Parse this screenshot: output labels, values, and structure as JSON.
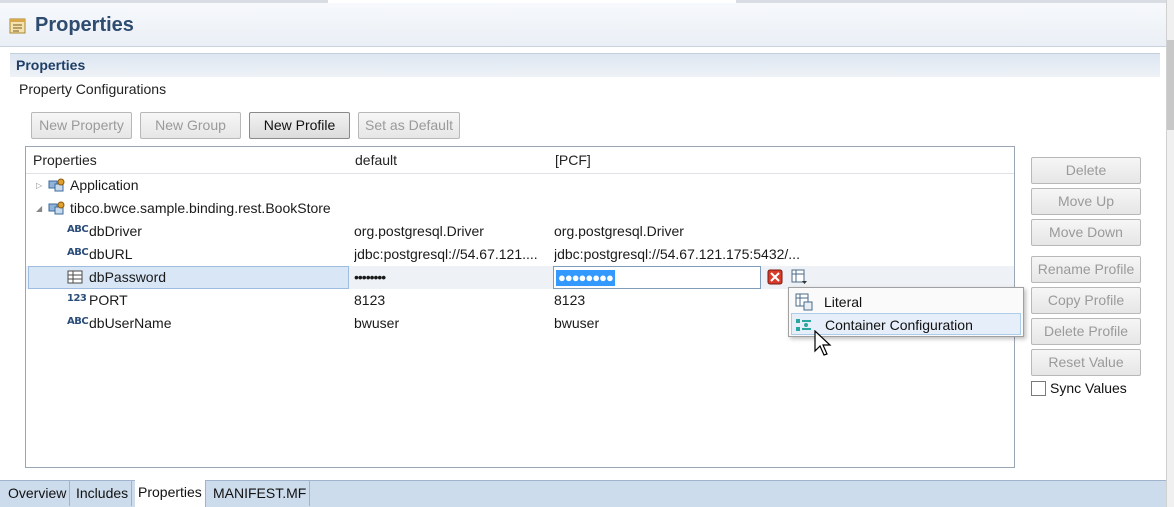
{
  "header": {
    "title": "Properties"
  },
  "section": {
    "title": "Properties",
    "subtitle": "Property Configurations"
  },
  "toolbar": {
    "new_property": "New Property",
    "new_group": "New Group",
    "new_profile": "New Profile",
    "set_default": "Set as Default"
  },
  "table": {
    "columns": [
      "Properties",
      "default",
      "[PCF]"
    ],
    "rows": [
      {
        "name": "Application",
        "icon": "group-icon",
        "expanded": false,
        "default": "",
        "pcf": ""
      },
      {
        "name": "tibco.bwce.sample.binding.rest.BookStore",
        "icon": "group-icon",
        "expanded": true,
        "default": "",
        "pcf": ""
      },
      {
        "name": "dbDriver",
        "icon": "abc-icon",
        "type_label": "ABC",
        "default": "org.postgresql.Driver",
        "pcf": "org.postgresql.Driver"
      },
      {
        "name": "dbURL",
        "icon": "abc-icon",
        "type_label": "ABC",
        "default": "jdbc:postgresql://54.67.121....",
        "pcf": "jdbc:postgresql://54.67.121.175:5432/..."
      },
      {
        "name": "dbPassword",
        "icon": "password-icon",
        "default": "••••••••",
        "pcf": "●●●●●●●●"
      },
      {
        "name": "PORT",
        "icon": "integer-icon",
        "type_label": "123",
        "default": "8123",
        "pcf": "8123"
      },
      {
        "name": "dbUserName",
        "icon": "abc-icon",
        "type_label": "ABC",
        "default": "bwuser",
        "pcf": "bwuser"
      }
    ]
  },
  "side_buttons": {
    "delete": "Delete",
    "move_up": "Move Up",
    "move_down": "Move Down",
    "rename_profile": "Rename Profile",
    "copy_profile": "Copy Profile",
    "delete_profile": "Delete Profile",
    "reset_value": "Reset Value"
  },
  "sync": {
    "label": "Sync Values",
    "checked": false
  },
  "popup_menu": {
    "items": [
      {
        "label": "Literal",
        "icon": "literal-icon"
      },
      {
        "label": "Container Configuration",
        "icon": "container-config-icon"
      }
    ]
  },
  "tabs": [
    "Overview",
    "Includes",
    "Properties",
    "MANIFEST.MF"
  ],
  "active_tab": "Properties",
  "colors": {
    "title": "#2e4b70",
    "selection": "#3399ff",
    "tabbar": "#cddcec"
  }
}
